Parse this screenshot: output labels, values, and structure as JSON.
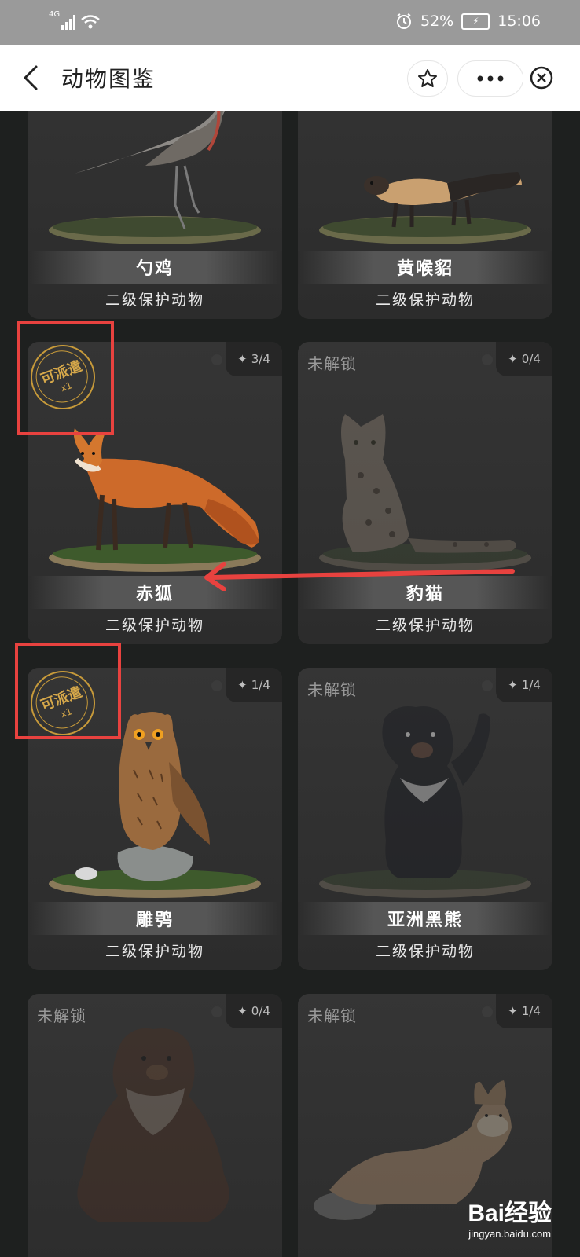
{
  "status_bar": {
    "network": "4G",
    "battery_percent": "52%",
    "time": "15:06"
  },
  "header": {
    "title": "动物图鉴",
    "back_icon": "chevron-left-icon",
    "favorite_icon": "star-icon",
    "more_icon": "more-dots-icon",
    "close_icon": "close-circle-icon"
  },
  "cards": [
    {
      "name": "勺鸡",
      "level": "二级保护动物"
    },
    {
      "name": "黄喉貂",
      "level": "二级保护动物"
    },
    {
      "name": "赤狐",
      "level": "二级保护动物",
      "pieces": "3/4",
      "dispatch": "可派遣",
      "dispatch_count": "x1"
    },
    {
      "name": "豹猫",
      "level": "二级保护动物",
      "pieces": "0/4",
      "locked": "未解锁"
    },
    {
      "name": "雕鸮",
      "level": "二级保护动物",
      "pieces": "1/4",
      "dispatch": "可派遣",
      "dispatch_count": "x1"
    },
    {
      "name": "亚洲黑熊",
      "level": "二级保护动物",
      "pieces": "1/4",
      "locked": "未解锁"
    },
    {
      "pieces": "0/4",
      "locked": "未解锁"
    },
    {
      "pieces": "1/4",
      "locked": "未解锁"
    }
  ],
  "watermark": {
    "logo": "Bai经验",
    "url": "jingyan.baidu.com"
  },
  "colors": {
    "annotation_red": "#e8423f",
    "stamp_gold": "#c79a3a",
    "background": "#1e201f"
  }
}
